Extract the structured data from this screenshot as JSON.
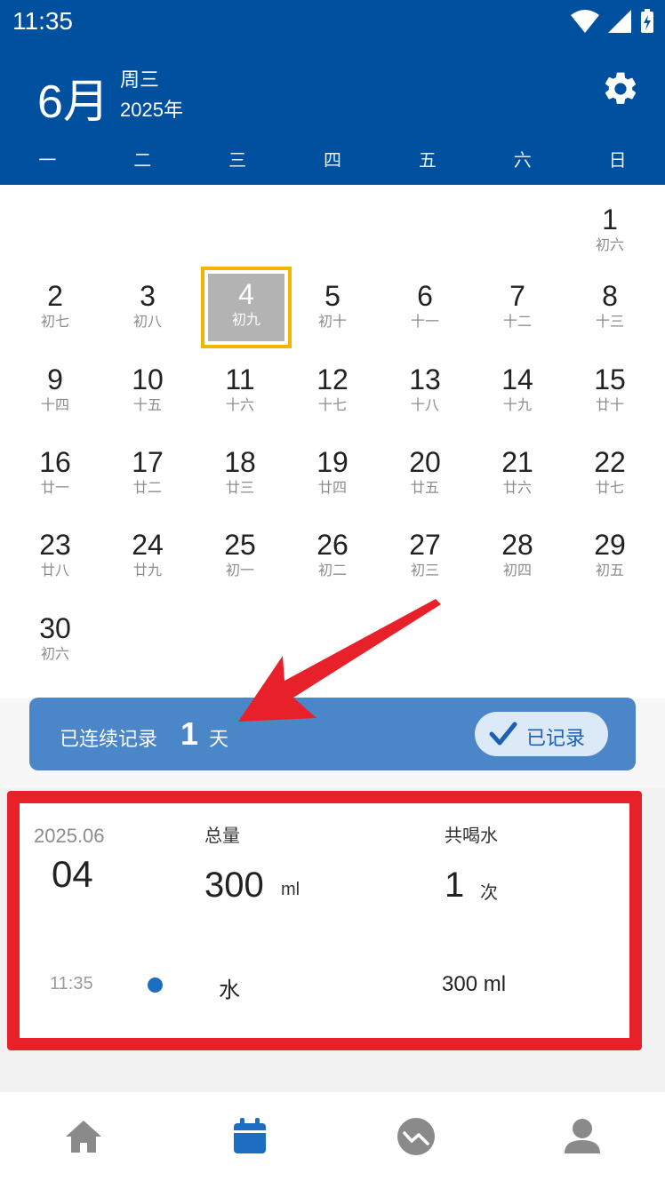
{
  "status_bar": {
    "time": "11:35"
  },
  "header": {
    "month": "6月",
    "weekday": "周三",
    "year": "2025年",
    "week_labels": [
      "一",
      "二",
      "三",
      "四",
      "五",
      "六",
      "日"
    ]
  },
  "calendar": {
    "selected_day": "4",
    "days": [
      {
        "d": "1",
        "l": "初六"
      },
      {
        "d": "2",
        "l": "初七"
      },
      {
        "d": "3",
        "l": "初八"
      },
      {
        "d": "4",
        "l": "初九"
      },
      {
        "d": "5",
        "l": "初十"
      },
      {
        "d": "6",
        "l": "十一"
      },
      {
        "d": "7",
        "l": "十二"
      },
      {
        "d": "8",
        "l": "十三"
      },
      {
        "d": "9",
        "l": "十四"
      },
      {
        "d": "10",
        "l": "十五"
      },
      {
        "d": "11",
        "l": "十六"
      },
      {
        "d": "12",
        "l": "十七"
      },
      {
        "d": "13",
        "l": "十八"
      },
      {
        "d": "14",
        "l": "十九"
      },
      {
        "d": "15",
        "l": "廿十"
      },
      {
        "d": "16",
        "l": "廿一"
      },
      {
        "d": "17",
        "l": "廿二"
      },
      {
        "d": "18",
        "l": "廿三"
      },
      {
        "d": "19",
        "l": "廿四"
      },
      {
        "d": "20",
        "l": "廿五"
      },
      {
        "d": "21",
        "l": "廿六"
      },
      {
        "d": "22",
        "l": "廿七"
      },
      {
        "d": "23",
        "l": "廿八"
      },
      {
        "d": "24",
        "l": "廿九"
      },
      {
        "d": "25",
        "l": "初一"
      },
      {
        "d": "26",
        "l": "初二"
      },
      {
        "d": "27",
        "l": "初三"
      },
      {
        "d": "28",
        "l": "初四"
      },
      {
        "d": "29",
        "l": "初五"
      },
      {
        "d": "30",
        "l": "初六"
      }
    ]
  },
  "streak": {
    "prefix": "已连续记录",
    "count": "1",
    "suffix": "天",
    "badge_label": "已记录"
  },
  "record": {
    "year_month": "2025.06",
    "day": "04",
    "total_label": "总量",
    "total_value": "300",
    "total_unit": "ml",
    "count_label": "共喝水",
    "count_value": "1",
    "count_unit": "次",
    "entries": [
      {
        "time": "11:35",
        "type": "水",
        "amount": "300 ml"
      }
    ]
  },
  "nav": {
    "items": [
      "home-icon",
      "calendar-icon",
      "trend-icon",
      "profile-icon"
    ],
    "active": "calendar-icon"
  },
  "colors": {
    "primary": "#0050a0",
    "streak_bar": "#4a86c8",
    "annotation_red": "#e8202a",
    "selected_border": "#f5b400"
  }
}
